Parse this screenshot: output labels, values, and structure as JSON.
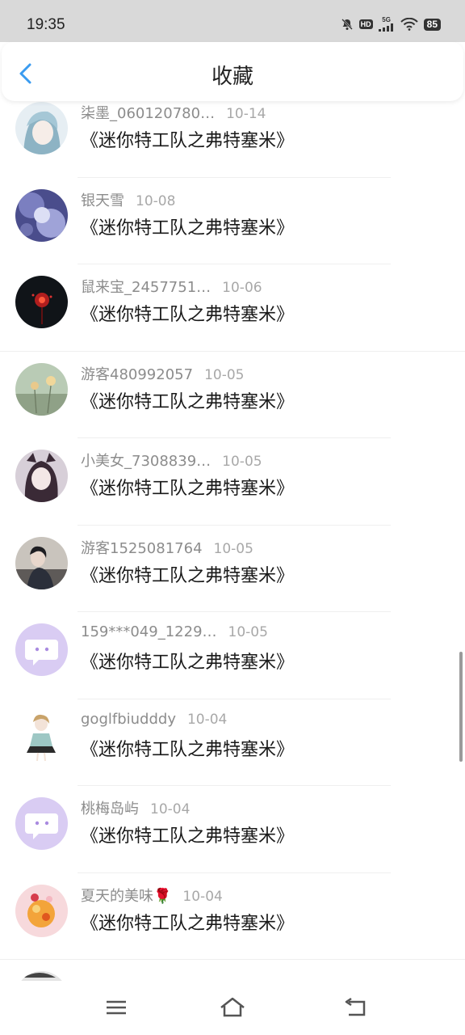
{
  "status_bar": {
    "time": "19:35",
    "icons": [
      "mute-bell-icon",
      "hd-icon",
      "signal-5g-icon",
      "wifi-icon",
      "battery-icon"
    ],
    "hd_label": "HD",
    "network_label": "5G",
    "battery_level": "85"
  },
  "header": {
    "title": "收藏",
    "back_icon": "chevron-left-icon",
    "accent_color": "#3a9bf0"
  },
  "items": [
    {
      "name": "柒墨_060120780…",
      "date": "10-14",
      "book": "《迷你特工队之弗特塞米》"
    },
    {
      "name": "银天雪",
      "date": "10-08",
      "book": "《迷你特工队之弗特塞米》"
    },
    {
      "name": "鼠来宝_2457751…",
      "date": "10-06",
      "book": "《迷你特工队之弗特塞米》"
    },
    {
      "name": "游客480992057",
      "date": "10-05",
      "book": "《迷你特工队之弗特塞米》"
    },
    {
      "name": "小美女_7308839…",
      "date": "10-05",
      "book": "《迷你特工队之弗特塞米》"
    },
    {
      "name": "游客1525081764",
      "date": "10-05",
      "book": "《迷你特工队之弗特塞米》"
    },
    {
      "name": "159***049_1229…",
      "date": "10-05",
      "book": "《迷你特工队之弗特塞米》"
    },
    {
      "name": "goglfbiudddy",
      "date": "10-04",
      "book": "《迷你特工队之弗特塞米》"
    },
    {
      "name": "桃梅岛屿",
      "date": "10-04",
      "book": "《迷你特工队之弗特塞米》"
    },
    {
      "name": "夏天的美味🌹",
      "date": "10-04",
      "book": "《迷你特工队之弗特塞米》"
    }
  ],
  "nav_bar": {
    "icons": [
      "menu-icon",
      "home-icon",
      "back-icon"
    ]
  }
}
